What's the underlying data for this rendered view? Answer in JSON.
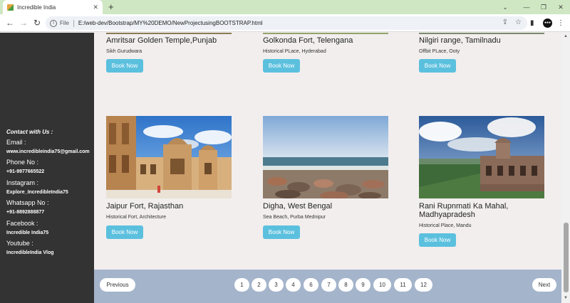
{
  "browser": {
    "tab_title": "Incredible India",
    "tab_close": "✕",
    "new_tab": "+",
    "url_scheme": "File",
    "url": "E:/web-dev/Bootstrap/MY%20DEMO/NewProjectusingBOOTSTRAP.html",
    "profile_label": "●●●"
  },
  "sidebar": {
    "heading": "Contact with Us :",
    "items": [
      {
        "label": "Email :",
        "value": "www.incredibleindia75@gmail.com"
      },
      {
        "label": "Phone No :",
        "value": "+91-9977665522"
      },
      {
        "label": "Instagram :",
        "value": "Explore_IncredibleIndia75"
      },
      {
        "label": "Whatsapp No :",
        "value": "+91-8892888877"
      },
      {
        "label": "Facebook :",
        "value": "Incredible India75"
      },
      {
        "label": "Youtube :",
        "value": "IncredibleIndia Vlog"
      }
    ]
  },
  "cards_top": [
    {
      "title": "Amritsar Golden Temple,Punjab",
      "subtitle": "Sikh Gurudwara",
      "button": "Book Now"
    },
    {
      "title": "Golkonda Fort, Telengana",
      "subtitle": "Historical PLace, Hyderabad",
      "button": "Book Now"
    },
    {
      "title": "Nilgiri range, Tamilnadu",
      "subtitle": "Offbit PLace, Ooty",
      "button": "Book Now"
    }
  ],
  "cards_bottom": [
    {
      "title": "Jaipur Fort, Rajasthan",
      "subtitle": "Historical Fort, Architecture",
      "button": "Book Now"
    },
    {
      "title": "Digha, West Bengal",
      "subtitle": "Sea Beach, Purba Mednipur",
      "button": "Book Now"
    },
    {
      "title_line1": "Rani Rupnmati Ka Mahal,",
      "title_line2": "Madhyapradesh",
      "subtitle": "Historical Place, Mandu",
      "button": "Book Now"
    }
  ],
  "pagination": {
    "previous": "Previous",
    "next": "Next",
    "pages": [
      "1",
      "2",
      "3",
      "4",
      "6",
      "7",
      "8",
      "9",
      "10",
      "11",
      "12"
    ]
  },
  "colors": {
    "sidebar_bg": "#333333",
    "button_bg": "#5bc0de",
    "pagination_bg": "#a4b4cb",
    "page_bg": "#f2eeee"
  }
}
